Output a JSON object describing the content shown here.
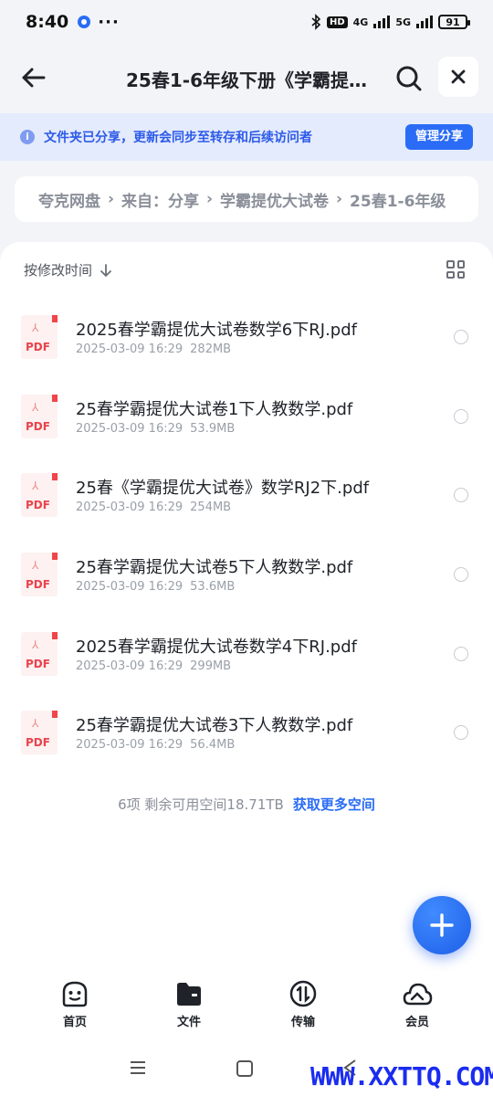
{
  "status_bar": {
    "time": "8:40",
    "more": "···",
    "network_4g": "4G",
    "network_5g": "5G",
    "hd": "HD",
    "battery": "91"
  },
  "header": {
    "title": "25春1-6年级下册《学霸提…"
  },
  "notice": {
    "text": "文件夹已分享，更新会同步至转存和后续访问者",
    "button": "管理分享"
  },
  "breadcrumb": [
    "夸克网盘",
    "来自：分享",
    "学霸提优大试卷",
    "25春1-6年级"
  ],
  "sort": {
    "label": "按修改时间"
  },
  "files": [
    {
      "name": "2025春学霸提优大试卷数学6下RJ.pdf",
      "date": "2025-03-09 16:29",
      "size": "282MB",
      "type": "PDF"
    },
    {
      "name": "25春学霸提优大试卷1下人教数学.pdf",
      "date": "2025-03-09 16:29",
      "size": "53.9MB",
      "type": "PDF"
    },
    {
      "name": "25春《学霸提优大试卷》数学RJ2下.pdf",
      "date": "2025-03-09 16:29",
      "size": "254MB",
      "type": "PDF"
    },
    {
      "name": "25春学霸提优大试卷5下人教数学.pdf",
      "date": "2025-03-09 16:29",
      "size": "53.6MB",
      "type": "PDF"
    },
    {
      "name": "2025春学霸提优大试卷数学4下RJ.pdf",
      "date": "2025-03-09 16:29",
      "size": "299MB",
      "type": "PDF"
    },
    {
      "name": "25春学霸提优大试卷3下人教数学.pdf",
      "date": "2025-03-09 16:29",
      "size": "56.4MB",
      "type": "PDF"
    }
  ],
  "footer": {
    "summary": "6项 剩余可用空间18.71TB",
    "link": "获取更多空间"
  },
  "nav": {
    "home": "首页",
    "files": "文件",
    "transfer": "传输",
    "vip": "会员"
  },
  "watermark": "WWW.XXTTQ.COM",
  "colors": {
    "accent": "#2a6cf6",
    "notice_bg": "#e4ebfd",
    "pdf_red": "#e9444c"
  }
}
